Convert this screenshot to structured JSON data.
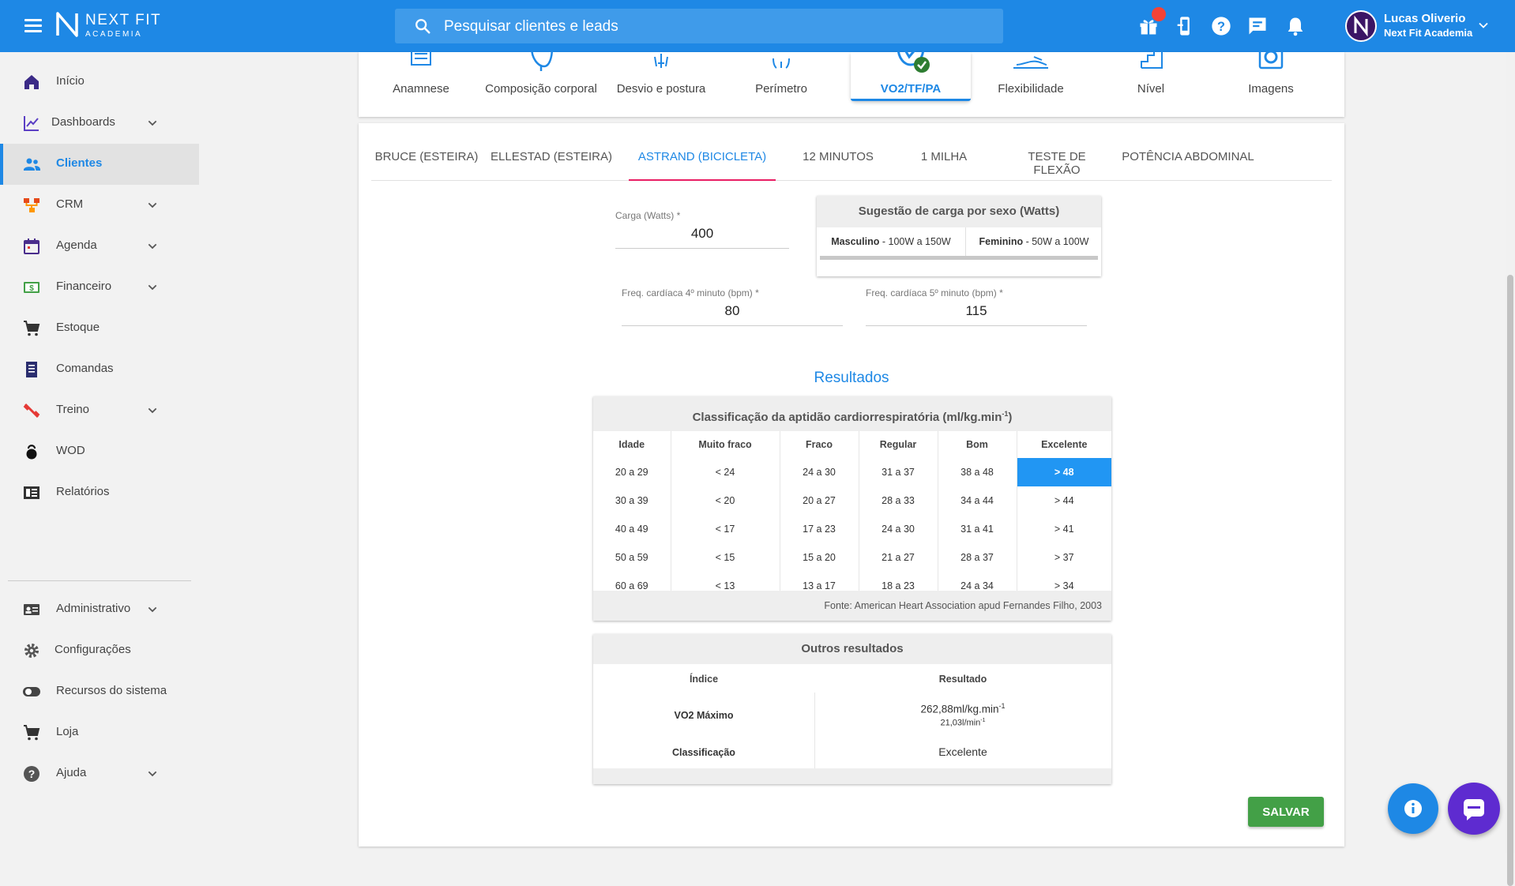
{
  "app": {
    "logo_text": "NEXT FIT",
    "logo_subtext": "ACADEMIA",
    "search_placeholder": "Pesquisar clientes e leads"
  },
  "user": {
    "name": "Lucas Oliverio",
    "company": "Next Fit Academia"
  },
  "sidebar": {
    "items": [
      {
        "label": "Início",
        "icon": "home-icon"
      },
      {
        "label": "Dashboards",
        "icon": "chart-line-icon",
        "expandable": true
      },
      {
        "label": "Clientes",
        "icon": "people-icon",
        "active": true
      },
      {
        "label": "CRM",
        "icon": "sitemap-icon",
        "expandable": true
      },
      {
        "label": "Agenda",
        "icon": "calendar-icon",
        "expandable": true
      },
      {
        "label": "Financeiro",
        "icon": "money-icon",
        "expandable": true
      },
      {
        "label": "Estoque",
        "icon": "cart-icon"
      },
      {
        "label": "Comandas",
        "icon": "receipt-icon"
      },
      {
        "label": "Treino",
        "icon": "dumbbell-icon",
        "expandable": true
      },
      {
        "label": "WOD",
        "icon": "kettlebell-icon"
      },
      {
        "label": "Relatórios",
        "icon": "report-icon"
      },
      {
        "label": "Administrativo",
        "icon": "id-card-icon",
        "expandable": true
      },
      {
        "label": "Configurações",
        "icon": "gear-icon"
      },
      {
        "label": "Recursos do sistema",
        "icon": "toggle-icon"
      },
      {
        "label": "Loja",
        "icon": "cart-icon"
      },
      {
        "label": "Ajuda",
        "icon": "help-icon",
        "expandable": true
      }
    ]
  },
  "assessment_tabs": [
    {
      "label": "Anamnese"
    },
    {
      "label": "Composição corporal"
    },
    {
      "label": "Desvio e postura"
    },
    {
      "label": "Perímetro"
    },
    {
      "label": "VO2/TF/PA",
      "active": true
    },
    {
      "label": "Flexibilidade"
    },
    {
      "label": "Nível"
    },
    {
      "label": "Imagens"
    }
  ],
  "protocol_tabs": [
    {
      "label": "BRUCE (ESTEIRA)"
    },
    {
      "label": "ELLESTAD (ESTEIRA)"
    },
    {
      "label": "ASTRAND (BICICLETA)",
      "active": true
    },
    {
      "label": "12 MINUTOS"
    },
    {
      "label": "1 MILHA"
    },
    {
      "label": "TESTE DE FLEXÃO"
    },
    {
      "label": "POTÊNCIA ABDOMINAL"
    }
  ],
  "form": {
    "carga_label": "Carga (Watts) *",
    "carga_value": "400",
    "fc4_label": "Freq. cardíaca 4º minuto (bpm) *",
    "fc4_value": "80",
    "fc5_label": "Freq. cardíaca 5º minuto (bpm) *",
    "fc5_value": "115"
  },
  "suggestion": {
    "title": "Sugestão de carga por sexo (Watts)",
    "male_label": "Masculino",
    "male_value": " - 100W a 150W",
    "female_label": "Feminino",
    "female_value": " - 50W a 100W"
  },
  "results": {
    "title": "Resultados",
    "classification": {
      "title": "Classificação da aptidão cardiorrespiratória (ml/kg.min",
      "title_sup": "-1",
      "title_end": ")",
      "headers": [
        "Idade",
        "Muito fraco",
        "Fraco",
        "Regular",
        "Bom",
        "Excelente"
      ],
      "rows": [
        [
          "20 a 29",
          "< 24",
          "24 a 30",
          "31 a 37",
          "38 a 48",
          "> 48"
        ],
        [
          "30 a 39",
          "< 20",
          "20 a 27",
          "28 a 33",
          "34 a 44",
          "> 44"
        ],
        [
          "40 a 49",
          "< 17",
          "17 a 23",
          "24 a 30",
          "31 a 41",
          "> 41"
        ],
        [
          "50 a 59",
          "< 15",
          "15 a 20",
          "21 a 27",
          "28 a 37",
          "> 37"
        ],
        [
          "60 a 69",
          "< 13",
          "13 a 17",
          "18 a 23",
          "24 a 34",
          "> 34"
        ]
      ],
      "highlight": {
        "row": 0,
        "col": 5
      },
      "source": "Fonte: American Heart Association apud Fernandes Filho, 2003"
    },
    "other": {
      "title": "Outros resultados",
      "col_index": "Índice",
      "col_result": "Resultado",
      "vo2_label": "VO2 Máximo",
      "vo2_value": "262,88ml/kg.min",
      "vo2_sup": "-1",
      "vo2_abs": "21,03l/min",
      "vo2_abs_sup": "-1",
      "class_label": "Classificação",
      "class_value": "Excelente"
    }
  },
  "save_label": "SALVAR",
  "colors": {
    "primary": "#1e88e5",
    "active_tab_indicator": "#e91e63",
    "highlight": "#2196f3",
    "save": "#43a047",
    "chat": "#5e2bd0"
  }
}
